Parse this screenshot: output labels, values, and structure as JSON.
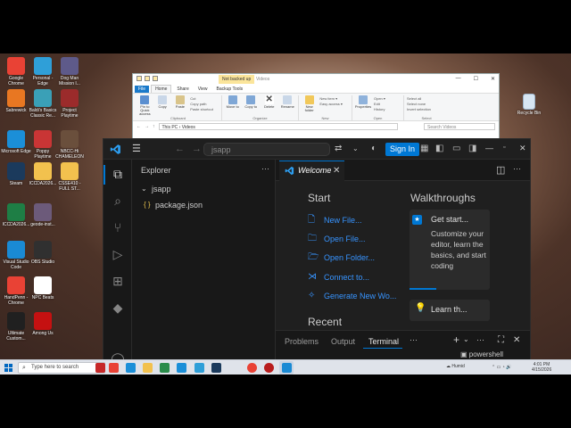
{
  "desktop": {
    "icons": [
      {
        "label": "Google Chrome",
        "color": "#e94235"
      },
      {
        "label": "Personal - Edge",
        "color": "#2f9fd8"
      },
      {
        "label": "Dog Man Mission I...",
        "color": "#5e5a8a"
      },
      {
        "label": "Sabrewick",
        "color": "#e87722"
      },
      {
        "label": "Baldi's Basics Classic Re...",
        "color": "#3aa0b7"
      },
      {
        "label": "Project Playtime",
        "color": "#9b2b2b"
      },
      {
        "label": "Microsoft Edge",
        "color": "#1b8fd8"
      },
      {
        "label": "Poppy Playtime",
        "color": "#c93535"
      },
      {
        "label": "NBCC-Hi CHAMELEON",
        "color": "#6a4f3c"
      },
      {
        "label": "Steam",
        "color": "#1b3a5c"
      },
      {
        "label": "ICCDA2026...",
        "color": "#f2c14e"
      },
      {
        "label": "CSSE410 - FULL ST...",
        "color": "#f2c14e"
      },
      {
        "label": "ICCDA2026...",
        "color": "#1e7e45"
      },
      {
        "label": "geode-inst...",
        "color": "#6c5a7a"
      },
      {
        "label": "Visual Studio Code",
        "color": "#1a8ad4"
      },
      {
        "label": "OBS Studio",
        "color": "#303030"
      },
      {
        "label": "HandPenn - Chrome",
        "color": "#e94235"
      },
      {
        "label": "NPC Beats",
        "color": "#ffffff"
      },
      {
        "label": "Ultimate Custom...",
        "color": "#202020"
      },
      {
        "label": "Among Us",
        "color": "#c51111"
      }
    ],
    "recycle_bin": "Recycle Bin"
  },
  "explorer": {
    "context_tab": "Not backed up",
    "title": "Videos",
    "manage_tab": "Manage",
    "ribbon_tabs": [
      "File",
      "Home",
      "Share",
      "View",
      "Backup Tools"
    ],
    "clipboard": {
      "buttons": [
        "Pin to Quick access",
        "Copy",
        "Paste"
      ],
      "small": [
        "Cut",
        "Copy path",
        "Paste shortcut"
      ],
      "label": "Clipboard"
    },
    "organize": {
      "buttons": [
        "Move to",
        "Copy to",
        "Delete",
        "Rename"
      ],
      "label": "Organize"
    },
    "new": {
      "buttons": [
        "New folder"
      ],
      "small": [
        "New item ▾",
        "Easy access ▾"
      ],
      "label": "New"
    },
    "open": {
      "buttons": [
        "Properties"
      ],
      "small": [
        "Open ▾",
        "Edit",
        "History"
      ],
      "label": "Open"
    },
    "select": {
      "small": [
        "Select all",
        "Select none",
        "Invert selection"
      ],
      "label": "Select"
    },
    "address": "This PC  ›  Videos",
    "search_placeholder": "Search Videos"
  },
  "vscode": {
    "command_center": "jsapp",
    "sign_in": "Sign In",
    "explorer_title": "Explorer",
    "folder": "jsapp",
    "file": "package.json",
    "tab_label": "Welcome",
    "start_heading": "Start",
    "start_items": [
      "New File...",
      "Open File...",
      "Open Folder...",
      "Connect to...",
      "Generate New Wo..."
    ],
    "walkthroughs_heading": "Walkthroughs",
    "get_started_title": "Get start...",
    "get_started_desc": "Customize your editor, learn the basics, and start coding",
    "learn_title": "Learn th...",
    "recent_heading": "Recent",
    "panel_tabs": [
      "Problems",
      "Output",
      "Terminal"
    ],
    "terminal_name": "powershell"
  },
  "taskbar": {
    "search_placeholder": "Type here to search",
    "weather": "Humid",
    "time": "4:01 PM",
    "date": "4/15/2026"
  }
}
